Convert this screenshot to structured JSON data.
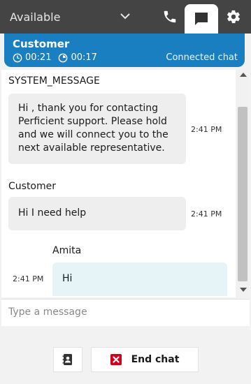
{
  "topbar": {
    "status_label": "Available",
    "icons": {
      "chevron": "chevron-down-icon",
      "phone": "phone-icon",
      "chat": "chat-icon",
      "settings": "gear-icon"
    },
    "background": "#444444"
  },
  "contact": {
    "name": "Customer",
    "timer_total": "00:21",
    "timer_state": "00:17",
    "state": "Connected chat",
    "color": "#1a7fc1"
  },
  "transcript": {
    "messages": [
      {
        "sender": "SYSTEM_MESSAGE",
        "text": "Hi , thank you for contacting Perficient support. Please hold and we will connect you to the next available representative.",
        "time": "2:41 PM",
        "direction": "in"
      },
      {
        "sender": "Customer",
        "text": "Hi I need help",
        "time": "2:41 PM",
        "direction": "in"
      },
      {
        "sender": "Amita",
        "text": "Hi",
        "time": "2:41 PM",
        "direction": "out"
      }
    ]
  },
  "composer": {
    "placeholder": "Type a message",
    "value": ""
  },
  "footer": {
    "end_chat_label": "End chat",
    "end_chat_color": "#d0021b"
  }
}
